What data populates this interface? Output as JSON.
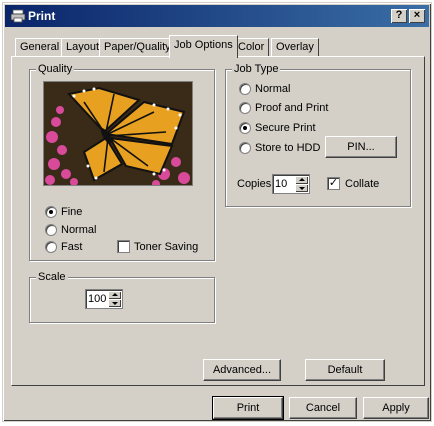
{
  "window": {
    "title": "Print",
    "help_label": "?",
    "close_label": "×"
  },
  "tabs": [
    {
      "label": "General"
    },
    {
      "label": "Layout"
    },
    {
      "label": "Paper/Quality"
    },
    {
      "label": "Job Options"
    },
    {
      "label": "Color"
    },
    {
      "label": "Overlay"
    }
  ],
  "active_tab": "Job Options",
  "quality": {
    "legend": "Quality",
    "options": [
      {
        "label": "Fine",
        "checked": true
      },
      {
        "label": "Normal",
        "checked": false
      },
      {
        "label": "Fast",
        "checked": false
      }
    ],
    "toner_saving": {
      "label": "Toner Saving",
      "checked": false
    }
  },
  "scale": {
    "legend": "Scale",
    "value": "100"
  },
  "job_type": {
    "legend": "Job Type",
    "options": [
      {
        "label": "Normal",
        "checked": false
      },
      {
        "label": "Proof and Print",
        "checked": false
      },
      {
        "label": "Secure Print",
        "checked": true
      },
      {
        "label": "Store to HDD",
        "checked": false
      }
    ],
    "pin_label": "PIN...",
    "copies_label": "Copies",
    "copies_value": "10",
    "collate": {
      "label": "Collate",
      "checked": true,
      "mark": "✓"
    }
  },
  "buttons": {
    "advanced": "Advanced...",
    "default": "Default",
    "print": "Print",
    "cancel": "Cancel",
    "apply": "Apply"
  },
  "colors": {
    "title_start": "#0a246a",
    "title_end": "#3a6ea5",
    "face": "#d4d0c8"
  }
}
